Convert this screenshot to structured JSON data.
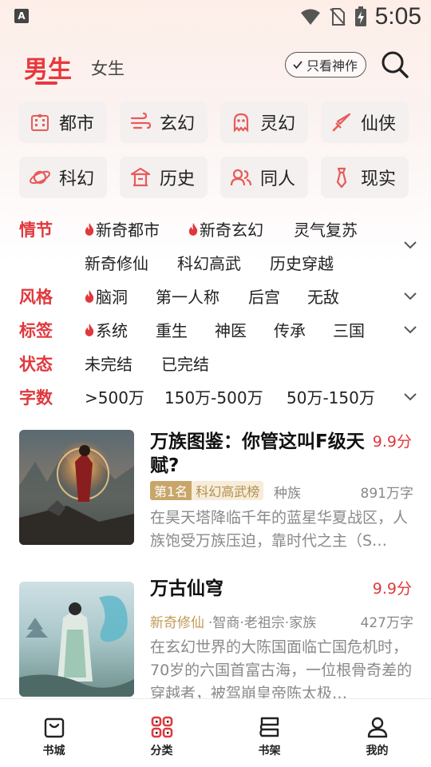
{
  "status_bar": {
    "time": "5:05",
    "app_icon_letter": "A",
    "icons": [
      "wifi-icon",
      "no-sim-icon",
      "battery-charging-icon"
    ]
  },
  "header": {
    "tabs": [
      {
        "label": "男生",
        "active": true
      },
      {
        "label": "女生",
        "active": false
      }
    ],
    "only_best_label": "只看神作",
    "search_icon": "search-icon"
  },
  "categories": [
    {
      "label": "都市",
      "icon": "building-icon"
    },
    {
      "label": "玄幻",
      "icon": "wind-icon"
    },
    {
      "label": "灵幻",
      "icon": "ghost-icon"
    },
    {
      "label": "仙侠",
      "icon": "sword-icon"
    },
    {
      "label": "科幻",
      "icon": "planet-icon"
    },
    {
      "label": "历史",
      "icon": "pavilion-icon"
    },
    {
      "label": "同人",
      "icon": "people-icon"
    },
    {
      "label": "现实",
      "icon": "tie-icon"
    }
  ],
  "filters": {
    "plot": {
      "label": "情节",
      "items": [
        "新奇都市",
        "新奇玄幻",
        "灵气复苏",
        "新奇修仙",
        "科幻高武",
        "历史穿越"
      ]
    },
    "style": {
      "label": "风格",
      "items": [
        "脑洞",
        "第一人称",
        "后宫",
        "无敌"
      ]
    },
    "tags": {
      "label": "标签",
      "items": [
        "系统",
        "重生",
        "神医",
        "传承",
        "三国"
      ]
    },
    "status": {
      "label": "状态",
      "items": [
        "未完结",
        "已完结"
      ]
    },
    "words": {
      "label": "字数",
      "items": [
        ">500万",
        "150万-500万",
        "50万-150万"
      ]
    }
  },
  "books": [
    {
      "title": "万族图鉴：你管这叫F级天赋?",
      "score": "9.9分",
      "rank_label": "第1名",
      "rank_list": "科幻高武榜",
      "tag": "种族",
      "words": "891万字",
      "description": "在昊天塔降临千年的蓝星华夏战区，人族饱受万族压迫，靠时代之主（S…"
    },
    {
      "title": "万古仙穹",
      "score": "9.9分",
      "genre": "新奇修仙",
      "tags": "·智商·老祖宗·家族",
      "words": "427万字",
      "description": "在玄幻世界的大陈国面临亡国危机时，70岁的六国首富古海，一位根骨奇差的穿越者，被驾崩皇帝陈太极…"
    }
  ],
  "bottom_nav": [
    {
      "label": "书城",
      "icon": "bookstore-bag-icon"
    },
    {
      "label": "分类",
      "icon": "category-grid-icon",
      "active": true
    },
    {
      "label": "书架",
      "icon": "bookshelf-icon"
    },
    {
      "label": "我的",
      "icon": "profile-icon"
    }
  ],
  "colors": {
    "accent": "#e0383d",
    "gold": "#c8a66a",
    "chip_bg": "#f3f0ef"
  }
}
